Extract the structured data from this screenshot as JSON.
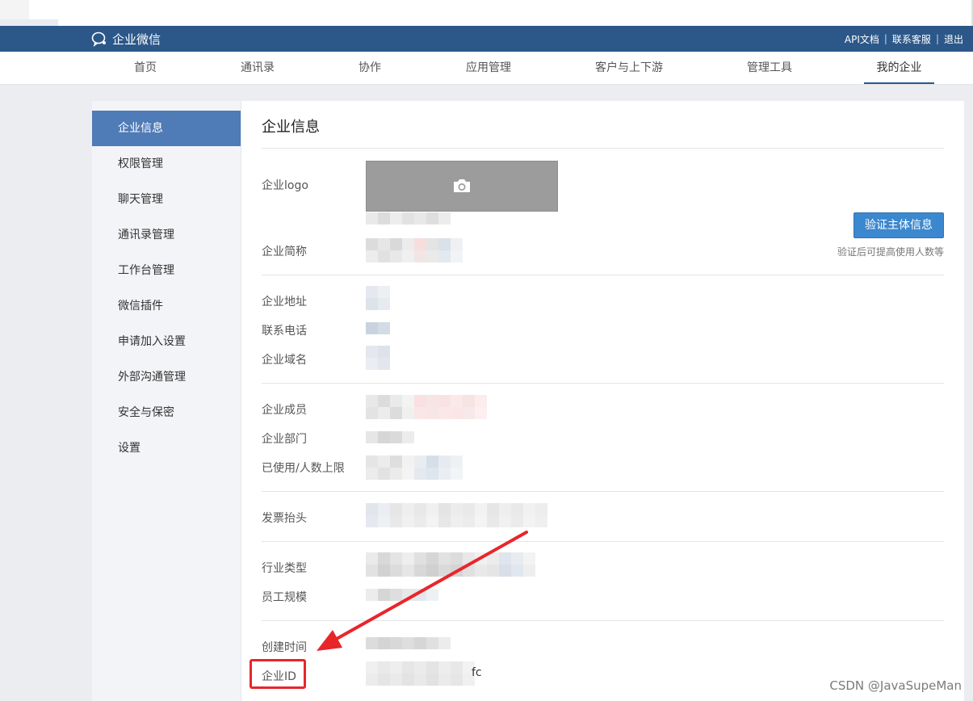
{
  "header": {
    "app_title": "企业微信",
    "links": [
      "API文档",
      "联系客服",
      "退出"
    ],
    "link_separator": "|"
  },
  "nav": {
    "items": [
      "首页",
      "通讯录",
      "协作",
      "应用管理",
      "客户与上下游",
      "管理工具",
      "我的企业"
    ],
    "active_index": 6
  },
  "sidebar": {
    "items": [
      "企业信息",
      "权限管理",
      "聊天管理",
      "通讯录管理",
      "工作台管理",
      "微信插件",
      "申请加入设置",
      "外部沟通管理",
      "安全与保密",
      "设置"
    ],
    "active_index": 0
  },
  "content": {
    "title": "企业信息",
    "labels": {
      "logo": "企业logo",
      "short_name": "企业简称",
      "address": "企业地址",
      "phone": "联系电话",
      "domain": "企业域名",
      "members": "企业成员",
      "departments": "企业部门",
      "used_limit": "已使用/人数上限",
      "invoice": "发票抬头",
      "industry": "行业类型",
      "staff_size": "员工规模",
      "created": "创建时间",
      "corp_id": "企业ID"
    },
    "verify_button": "验证主体信息",
    "verify_note": "验证后可提高使用人数等",
    "corp_id_visible_suffix": "fc"
  },
  "annotation": {
    "highlight_color": "#e8262a"
  },
  "watermark": "CSDN @JavaSupeMan",
  "colors": {
    "header_bg": "#2c5789",
    "sidebar_active": "#4f7bb6",
    "button": "#3c88cf"
  }
}
